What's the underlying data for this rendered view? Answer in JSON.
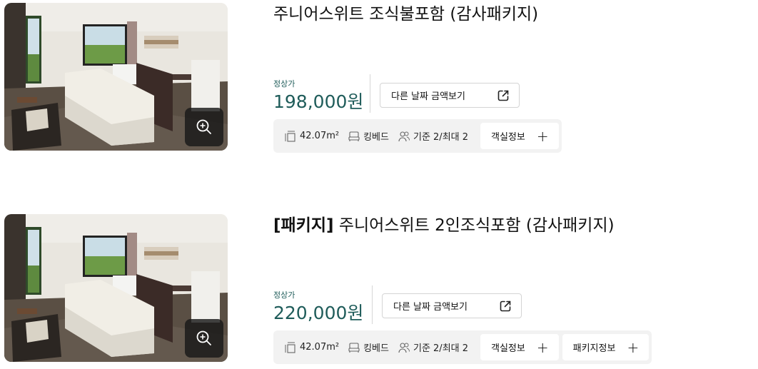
{
  "rooms": [
    {
      "title_tag": "",
      "title": "주니어스위트 조식불포함 (감사패키지)",
      "price_label": "정상가",
      "price": "198,000원",
      "other_date_label": "다른 날짜 금액보기",
      "specs": {
        "area": "42.07m²",
        "bed": "킹베드",
        "capacity": "기준 2/최대 2"
      },
      "buttons": [
        {
          "label": "객실정보",
          "icon": "plus-icon"
        }
      ]
    },
    {
      "title_tag": "[패키지]",
      "title": "주니어스위트 2인조식포함 (감사패키지)",
      "price_label": "정상가",
      "price": "220,000원",
      "other_date_label": "다른 날짜 금액보기",
      "specs": {
        "area": "42.07m²",
        "bed": "킹베드",
        "capacity": "기준 2/최대 2"
      },
      "buttons": [
        {
          "label": "객실정보",
          "icon": "plus-icon"
        },
        {
          "label": "패키지정보",
          "icon": "plus-icon"
        }
      ]
    }
  ],
  "icons": {
    "zoom": "zoom-in-icon",
    "external": "external-link-icon",
    "area": "area-icon",
    "bed": "bed-icon",
    "capacity": "people-icon"
  },
  "colors": {
    "price": "#1f5c5a",
    "info_bar": "#f2f2f2",
    "zoom_button": "#191919"
  }
}
